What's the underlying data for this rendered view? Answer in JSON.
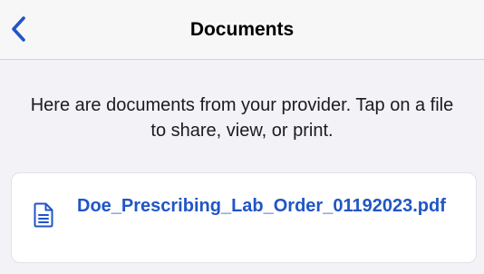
{
  "nav": {
    "back_icon": "chevron-left-icon",
    "title": "Documents"
  },
  "intro": {
    "text": "Here are documents from your provider. Tap on a file to share, view, or print."
  },
  "files": [
    {
      "icon": "document-icon",
      "name": "Doe_Prescribing_Lab_Order_01192023.pdf"
    }
  ],
  "colors": {
    "accent": "#2056c5",
    "background": "#f2f2f7",
    "card": "#ffffff"
  }
}
